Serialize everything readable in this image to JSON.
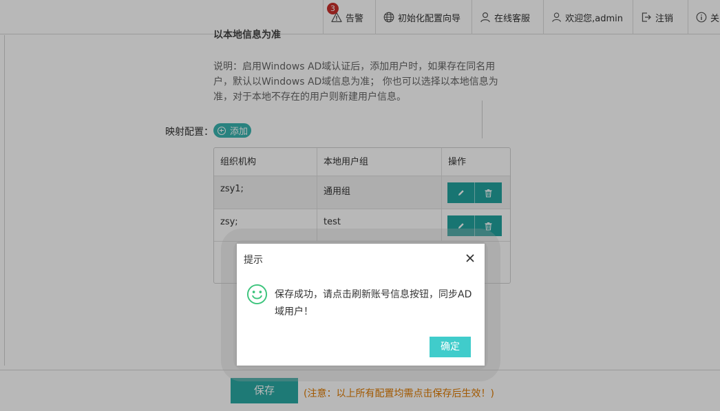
{
  "header": {
    "alarm": {
      "badge": "3",
      "label": "告警"
    },
    "wizard": {
      "label": "初始化配置向导"
    },
    "service": {
      "label": "在线客服"
    },
    "user": {
      "label": "欢迎您,admin"
    },
    "logout": {
      "label": "注销"
    },
    "about": {
      "label": "关"
    }
  },
  "main": {
    "cut_heading": "以本地信息为准",
    "description": "说明：启用Windows AD域认证后，添加用户时，如果存在同名用户，默认以Windows AD域信息为准； 你也可以选择以本地信息为准，对于本地不存在的用户则新建用户信息。",
    "mapping_label": "映射配置：",
    "add_label": "添加",
    "table": {
      "columns": [
        "组织机构",
        "本地用户组",
        "操作"
      ],
      "rows": [
        {
          "org": "zsy1;",
          "group": "通用组"
        },
        {
          "org": "zsy;",
          "group": "test"
        }
      ]
    }
  },
  "footer": {
    "save_label": "保存",
    "note": "(注意：以上所有配置均需点击保存后生效！)"
  },
  "dialog": {
    "title": "提示",
    "message": "保存成功，请点击刷新账号信息按钮，同步AD域用户！",
    "ok_label": "确定"
  },
  "colors": {
    "accent": "#2aa9a4",
    "ok_button": "#40cccb",
    "note": "#e07b00",
    "badge": "#c9302c",
    "smile_icon": "#3cc47c"
  }
}
